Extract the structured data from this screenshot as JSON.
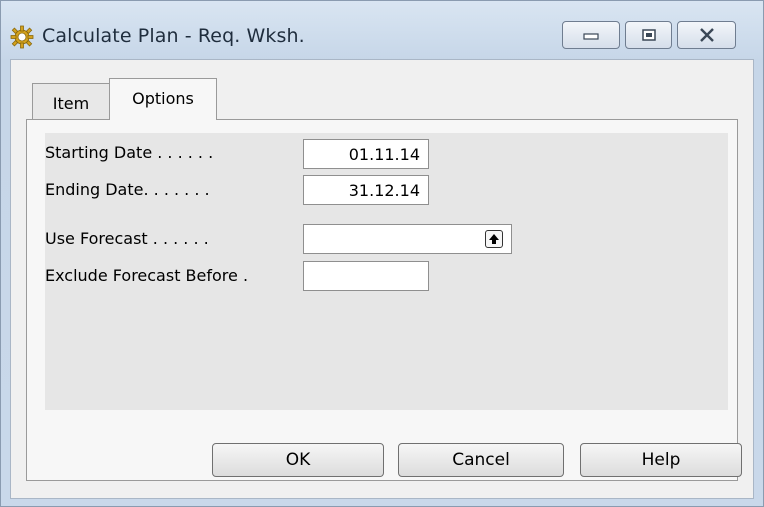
{
  "window": {
    "title": "Calculate Plan - Req. Wksh.",
    "icon": "gear-icon"
  },
  "tabs": [
    {
      "label": "Item",
      "selected": false
    },
    {
      "label": "Options",
      "selected": true
    }
  ],
  "fields": {
    "starting_date": {
      "label": "Starting Date . . . . . .",
      "value": "01.11.14"
    },
    "ending_date": {
      "label": "Ending Date. . . . . . .",
      "value": "31.12.14"
    },
    "use_forecast": {
      "label": "Use Forecast . . . . . .",
      "value": ""
    },
    "exclude_forecast_before": {
      "label": "Exclude Forecast Before .",
      "value": ""
    }
  },
  "buttons": {
    "ok": "OK",
    "cancel": "Cancel",
    "help": "Help"
  }
}
